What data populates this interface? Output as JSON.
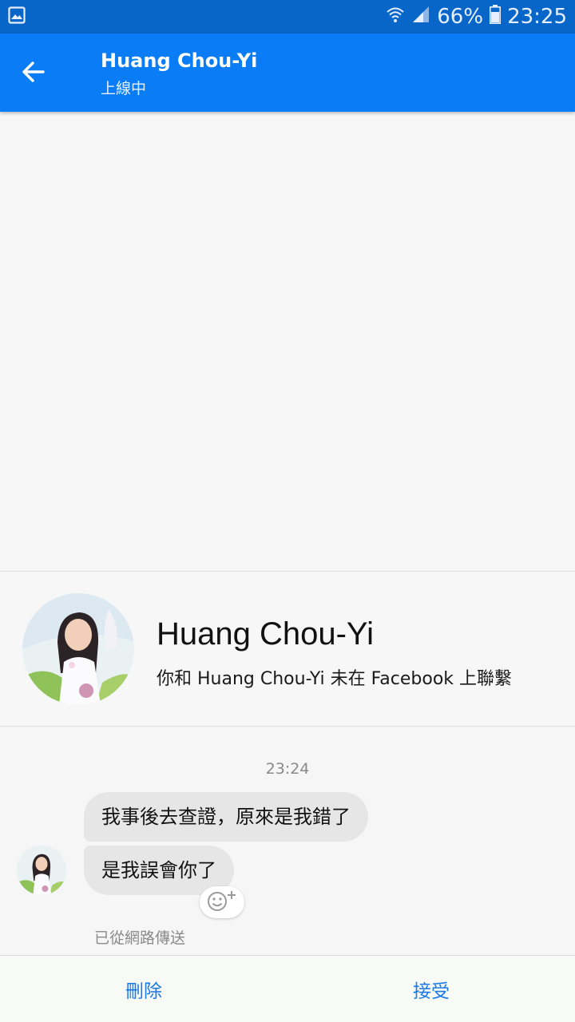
{
  "status_bar": {
    "battery": "66%",
    "time": "23:25",
    "icons": [
      "gallery-icon",
      "wifi-icon",
      "signal-icon",
      "battery-icon"
    ]
  },
  "header": {
    "title": "Huang Chou-Yi",
    "subtitle": "上線中"
  },
  "profile": {
    "name": "Huang Chou-Yi",
    "note": "你和 Huang Chou-Yi 未在 Facebook 上聯繫"
  },
  "conversation": {
    "timestamp": "23:24",
    "messages": [
      {
        "text": "我事後去查證，原來是我錯了"
      },
      {
        "text": "是我誤會你了"
      }
    ],
    "delivery_status": "已從網路傳送"
  },
  "actions": {
    "delete_label": "刪除",
    "accept_label": "接受"
  },
  "colors": {
    "status_bar": "#0866c9",
    "app_bar": "#0a7cf5",
    "action_text": "#1b78e6",
    "bubble": "#e6e6e6"
  }
}
